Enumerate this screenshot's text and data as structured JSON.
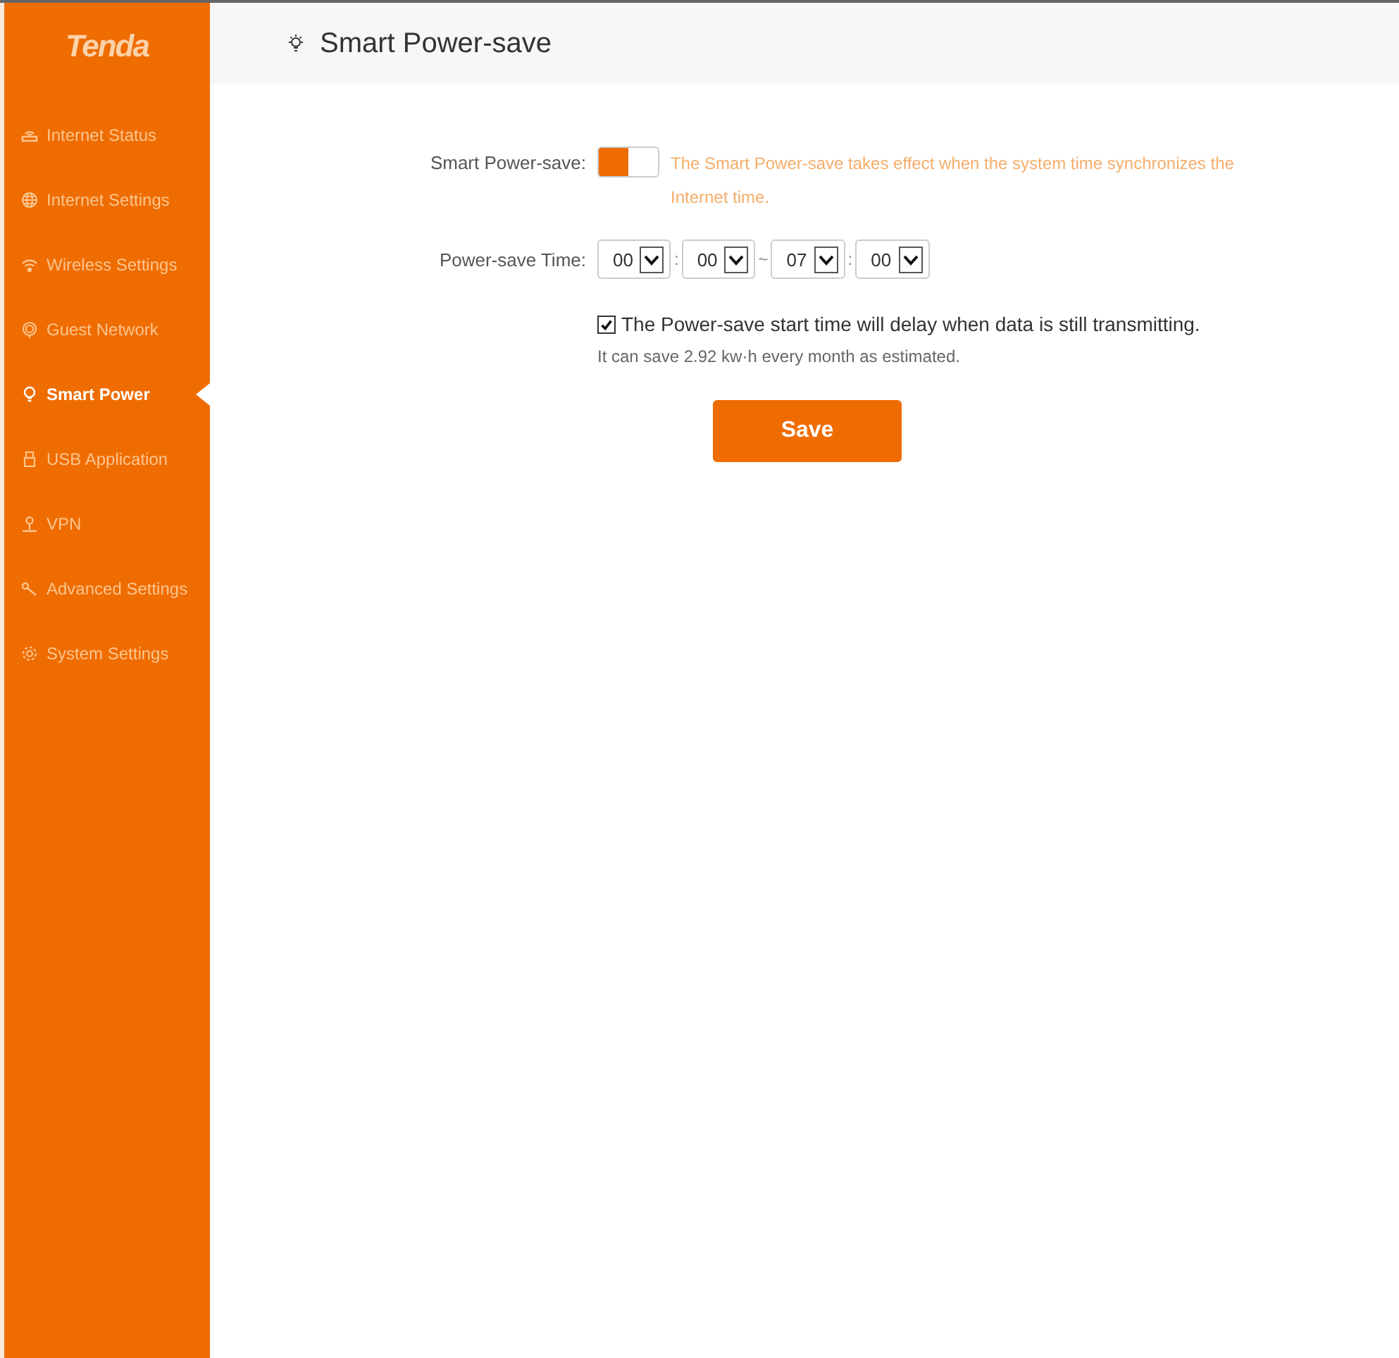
{
  "logo": "Tenda",
  "sidebar": {
    "items": [
      {
        "label": "Internet Status",
        "selected": false
      },
      {
        "label": "Internet Settings",
        "selected": false
      },
      {
        "label": "Wireless Settings",
        "selected": false
      },
      {
        "label": "Guest Network",
        "selected": false
      },
      {
        "label": "Smart Power",
        "selected": true
      },
      {
        "label": "USB Application",
        "selected": false
      },
      {
        "label": "VPN",
        "selected": false
      },
      {
        "label": "Advanced Settings",
        "selected": false
      },
      {
        "label": "System Settings",
        "selected": false
      }
    ]
  },
  "header": {
    "title": "Smart Power-save"
  },
  "form": {
    "power_save_label": "Smart Power-save:",
    "power_save_on": true,
    "power_save_hint": "The Smart Power-save takes effect when the system time synchronizes the Internet time.",
    "time_label": "Power-save Time:",
    "times": [
      {
        "value": "00",
        "separator": ":"
      },
      {
        "value": "00",
        "separator": "~"
      },
      {
        "value": "07",
        "separator": ":"
      },
      {
        "value": "00"
      }
    ],
    "delay_checked": true,
    "delay_label": "The Power-save start time will delay when data is still transmitting.",
    "estimate": "It can save 2.92 kw·h every month as estimated.",
    "save_button": "Save"
  }
}
